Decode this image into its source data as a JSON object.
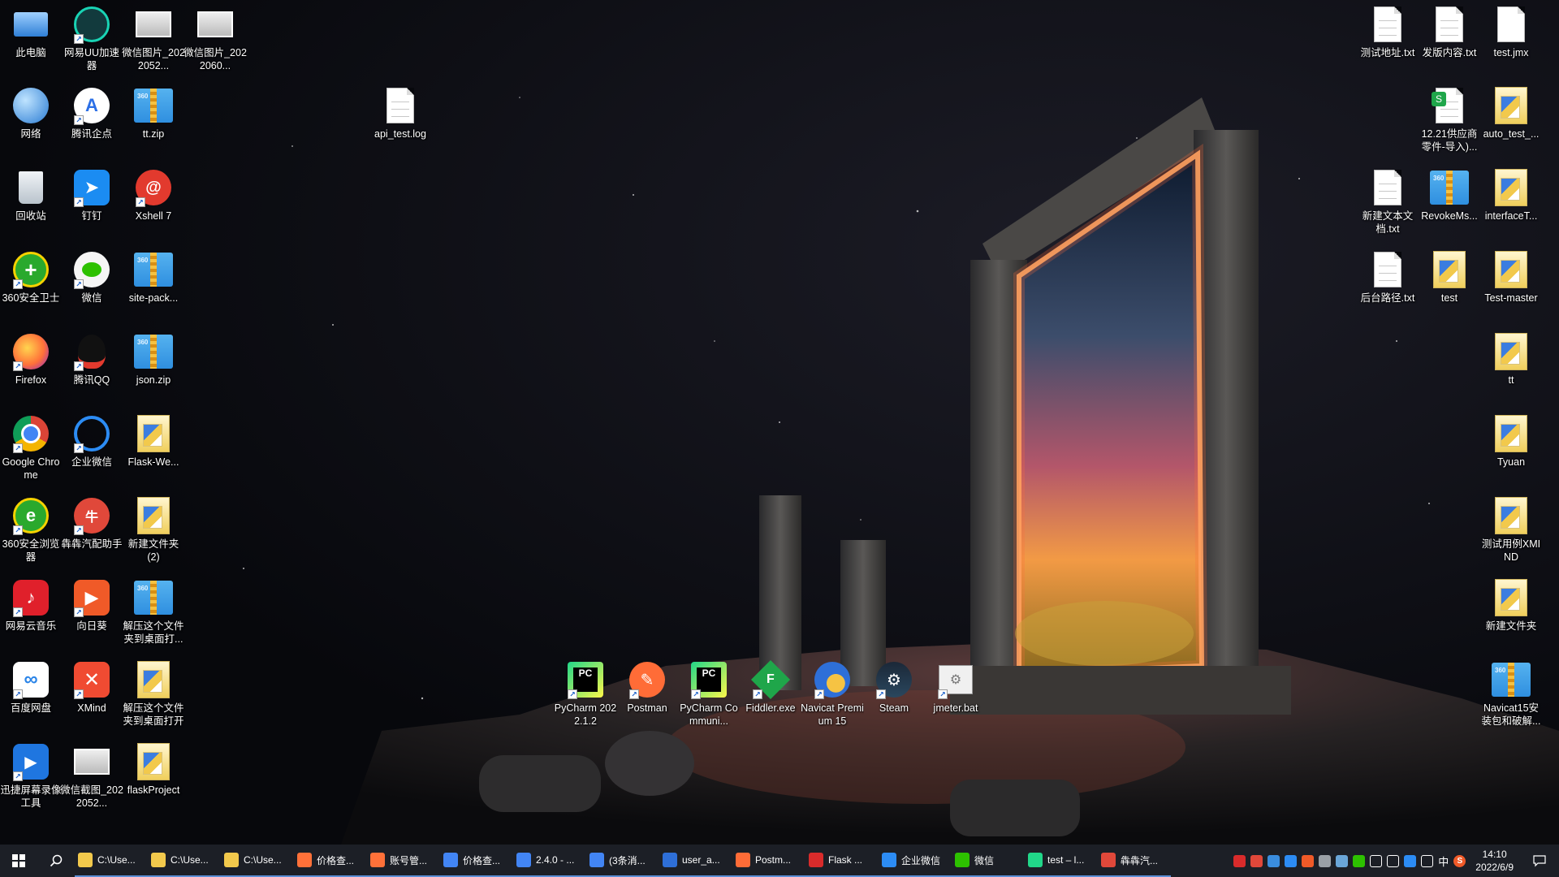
{
  "desktop_left": [
    {
      "label": "此电脑",
      "icon": "computer-icon"
    },
    {
      "label": "网易UU加速器",
      "icon": "uu-accelerator-icon"
    },
    {
      "label": "微信图片_2022052...",
      "icon": "image-file-icon"
    },
    {
      "label": "微信图片_2022060...",
      "icon": "image-file-icon"
    },
    {
      "label": "网络",
      "icon": "network-icon"
    },
    {
      "label": "腾讯企点",
      "icon": "tencent-qidian-icon"
    },
    {
      "label": "tt.zip",
      "icon": "zip-archive-icon"
    },
    {
      "label": "回收站",
      "icon": "recycle-bin-icon"
    },
    {
      "label": "钉钉",
      "icon": "dingtalk-icon"
    },
    {
      "label": "Xshell 7",
      "icon": "xshell-icon"
    },
    {
      "label": "360安全卫士",
      "icon": "360-security-icon"
    },
    {
      "label": "微信",
      "icon": "wechat-icon"
    },
    {
      "label": "site-pack...",
      "icon": "zip-archive-icon"
    },
    {
      "label": "Firefox",
      "icon": "firefox-icon"
    },
    {
      "label": "腾讯QQ",
      "icon": "qq-icon"
    },
    {
      "label": "json.zip",
      "icon": "zip-archive-icon"
    },
    {
      "label": "Google Chrome",
      "icon": "chrome-icon"
    },
    {
      "label": "企业微信",
      "icon": "wecom-icon"
    },
    {
      "label": "Flask-We...",
      "icon": "folder-icon"
    },
    {
      "label": "360安全浏览器",
      "icon": "360-browser-icon"
    },
    {
      "label": "犇犇汽配助手",
      "icon": "benben-icon"
    },
    {
      "label": "新建文件夹 (2)",
      "icon": "folder-icon"
    },
    {
      "label": "网易云音乐",
      "icon": "netease-music-icon"
    },
    {
      "label": "向日葵",
      "icon": "sunlogin-icon"
    },
    {
      "label": "解压这个文件夹到桌面打...",
      "icon": "zip-archive-icon"
    },
    {
      "label": "百度网盘",
      "icon": "baidu-netdisk-icon"
    },
    {
      "label": "XMind",
      "icon": "xmind-icon"
    },
    {
      "label": "解压这个文件夹到桌面打开",
      "icon": "folder-icon"
    },
    {
      "label": "迅捷屏幕录像工具",
      "icon": "screen-recorder-icon"
    },
    {
      "label": "微信截图_2022052...",
      "icon": "image-file-icon"
    },
    {
      "label": "flaskProject",
      "icon": "folder-icon"
    }
  ],
  "desktop_middle": [
    {
      "label": "api_test.log",
      "icon": "text-file-icon"
    }
  ],
  "desktop_bottom": [
    {
      "label": "PyCharm 2022.1.2",
      "icon": "pycharm-icon"
    },
    {
      "label": "Postman",
      "icon": "postman-icon"
    },
    {
      "label": "PyCharm Communi...",
      "icon": "pycharm-icon"
    },
    {
      "label": "Fiddler.exe",
      "icon": "fiddler-icon"
    },
    {
      "label": "Navicat Premium 15",
      "icon": "navicat-icon"
    },
    {
      "label": "Steam",
      "icon": "steam-icon"
    },
    {
      "label": "jmeter.bat",
      "icon": "batch-file-icon"
    }
  ],
  "desktop_right": [
    {
      "label": "测试地址.txt",
      "icon": "text-file-icon"
    },
    {
      "label": "发版内容.txt",
      "icon": "text-file-icon"
    },
    {
      "label": "test.jmx",
      "icon": "file-icon"
    },
    {
      "label": "12.21供应商零件-导入)...",
      "icon": "spreadsheet-icon"
    },
    {
      "label": "auto_test_...",
      "icon": "folder-icon"
    },
    {
      "label": "新建文本文档.txt",
      "icon": "text-file-icon"
    },
    {
      "label": "RevokeMs...",
      "icon": "zip-archive-icon"
    },
    {
      "label": "interfaceT...",
      "icon": "folder-icon"
    },
    {
      "label": "后台路径.txt",
      "icon": "text-file-icon"
    },
    {
      "label": "test",
      "icon": "folder-icon"
    },
    {
      "label": "Test-master",
      "icon": "folder-icon"
    },
    {
      "label": "tt",
      "icon": "folder-icon"
    },
    {
      "label": "Tyuan",
      "icon": "folder-icon"
    },
    {
      "label": "测试用例XMIND",
      "icon": "folder-icon"
    },
    {
      "label": "新建文件夹",
      "icon": "folder-icon"
    },
    {
      "label": "Navicat15安装包和破解...",
      "icon": "zip-archive-icon"
    }
  ],
  "taskbar": {
    "items": [
      {
        "label": "C:\\Use...",
        "icon": "file-explorer-icon",
        "color": "#f2c94c"
      },
      {
        "label": "C:\\Use...",
        "icon": "file-explorer-icon",
        "color": "#f2c94c"
      },
      {
        "label": "C:\\Use...",
        "icon": "file-explorer-icon",
        "color": "#f2c94c"
      },
      {
        "label": "价格查...",
        "icon": "firefox-icon",
        "color": "#ff7139"
      },
      {
        "label": "账号管...",
        "icon": "firefox-icon",
        "color": "#ff7139"
      },
      {
        "label": "价格查...",
        "icon": "chrome-icon",
        "color": "#4285f4"
      },
      {
        "label": "2.4.0 - ...",
        "icon": "chrome-icon",
        "color": "#4285f4"
      },
      {
        "label": "(3条消...",
        "icon": "chrome-icon",
        "color": "#4285f4"
      },
      {
        "label": "user_a...",
        "icon": "navicat-icon",
        "color": "#2e6fd8"
      },
      {
        "label": "Postm...",
        "icon": "postman-icon",
        "color": "#ff6c37"
      },
      {
        "label": "Flask ...",
        "icon": "wps-icon",
        "color": "#d92b2b"
      },
      {
        "label": "企业微信",
        "icon": "wecom-icon",
        "color": "#2c8cf4"
      },
      {
        "label": "微信",
        "icon": "wechat-icon",
        "color": "#2dc100"
      },
      {
        "label": "test – l...",
        "icon": "pycharm-icon",
        "color": "#21d789"
      },
      {
        "label": "犇犇汽...",
        "icon": "benben-icon",
        "color": "#e0483a"
      }
    ],
    "tray": [
      {
        "icon": "wps-tray-icon",
        "color": "#d92b2b"
      },
      {
        "icon": "benben-tray-icon",
        "color": "#e0483a"
      },
      {
        "icon": "screenshot-tray-icon",
        "color": "#3a8dde"
      },
      {
        "icon": "search-tray-icon",
        "color": "#2c8cf4"
      },
      {
        "icon": "sunlogin-tray-icon",
        "color": "#f05a28"
      },
      {
        "icon": "camera-tray-icon",
        "color": "#9aa0a6"
      },
      {
        "icon": "steam-tray-icon",
        "color": "#6aa6d8"
      },
      {
        "icon": "wechat-tray-icon",
        "color": "#2dc100"
      },
      {
        "icon": "volume-tray-icon",
        "color": "#ffffff"
      },
      {
        "icon": "network-tray-icon",
        "color": "#ffffff"
      },
      {
        "icon": "bluetooth-tray-icon",
        "color": "#2c8cf4"
      },
      {
        "icon": "display-tray-icon",
        "color": "#ffffff"
      }
    ],
    "ime": "中",
    "sogou": "S",
    "time": "14:10",
    "date": "2022/6/9"
  }
}
